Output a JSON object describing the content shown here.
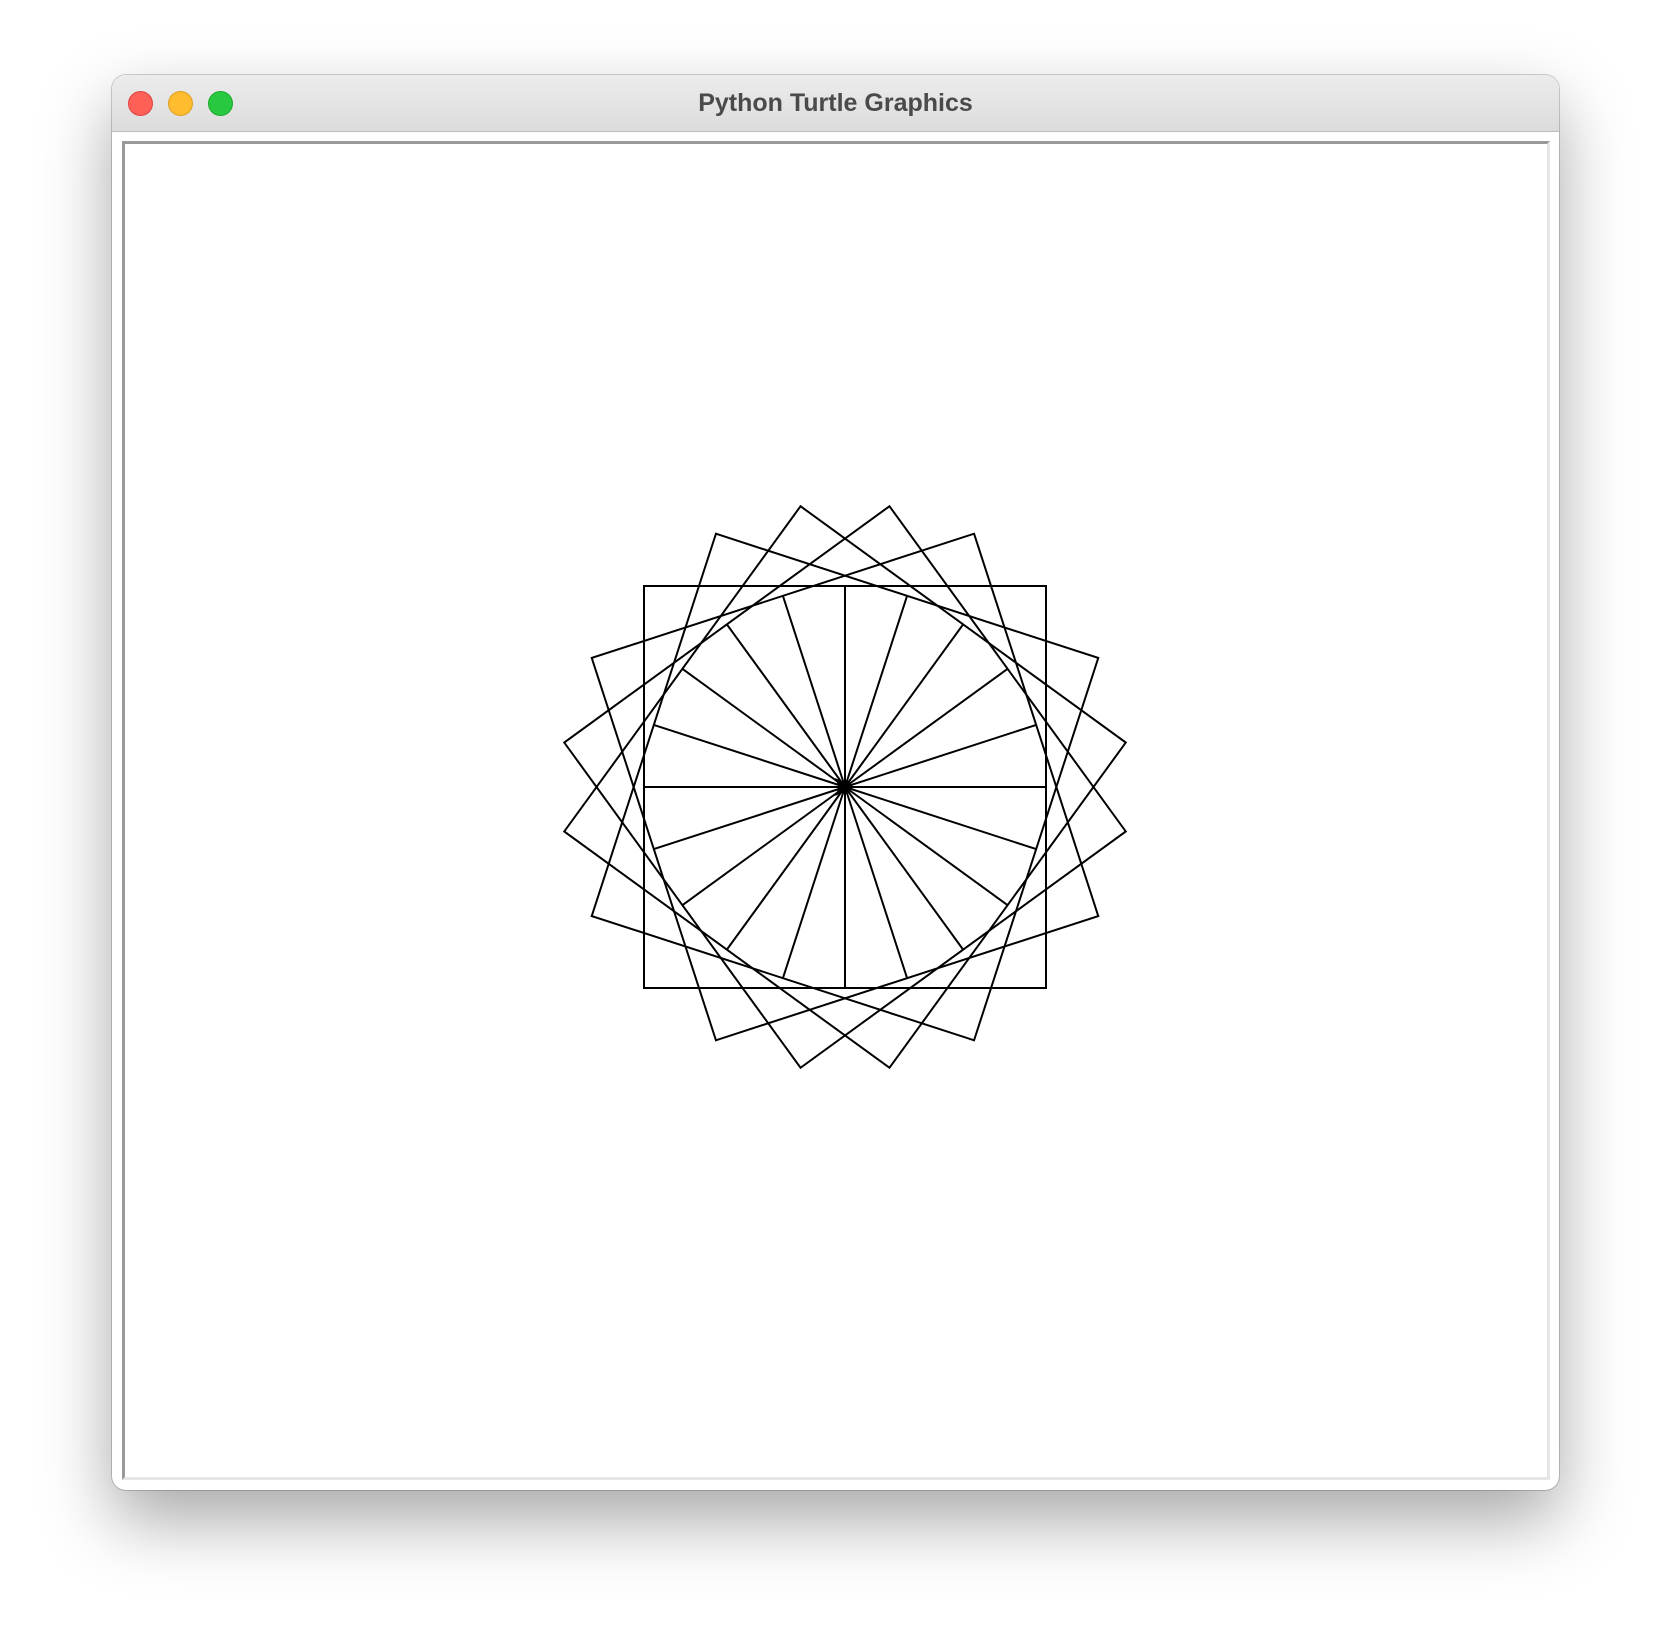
{
  "window": {
    "title": "Python Turtle Graphics"
  },
  "titlebar_buttons": {
    "close_color": "#fe5f57",
    "minimize_color": "#febc2e",
    "zoom_color": "#28c840"
  },
  "drawing": {
    "pen_color": "#000000",
    "background_color": "#ffffff",
    "square_count": 5,
    "rotation_step_degrees": 18,
    "ray_count": 20,
    "turtle_icon": "triangle-arrow-icon"
  }
}
